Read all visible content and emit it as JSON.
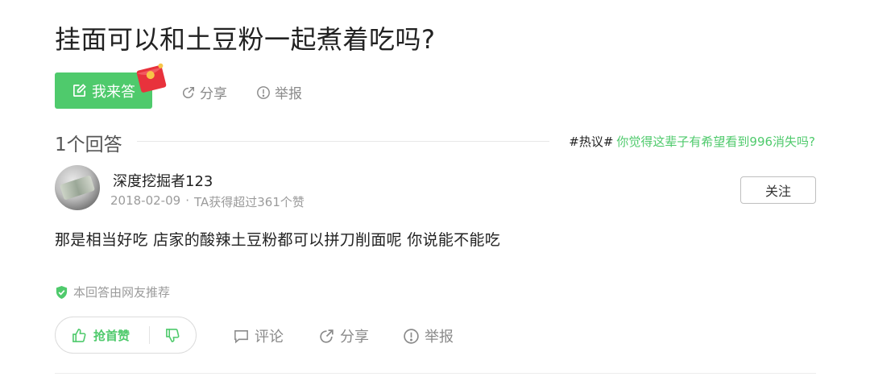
{
  "question": {
    "title": "挂面可以和土豆粉一起煮着吃吗?"
  },
  "actions": {
    "answer_label": "我来答",
    "share_label": "分享",
    "report_label": "举报"
  },
  "answers_header": {
    "count_label": "1个回答",
    "hot_tag": "#热议#",
    "hot_text": "你觉得这辈子有希望看到996消失吗?"
  },
  "answer": {
    "author": "深度挖掘者123",
    "date": "2018-02-09",
    "separator": "·",
    "likes_text": "TA获得超过361个赞",
    "follow_label": "关注",
    "content": "那是相当好吃 店家的酸辣土豆粉都可以拼刀削面呢 你说能不能吃",
    "recommend_text": "本回答由网友推荐",
    "upvote_label": "抢首赞",
    "comment_label": "评论",
    "share_label": "分享",
    "report_label": "举报"
  },
  "colors": {
    "accent": "#4fca6c",
    "envelope": "#e8323c",
    "muted": "#9b9b9b"
  }
}
